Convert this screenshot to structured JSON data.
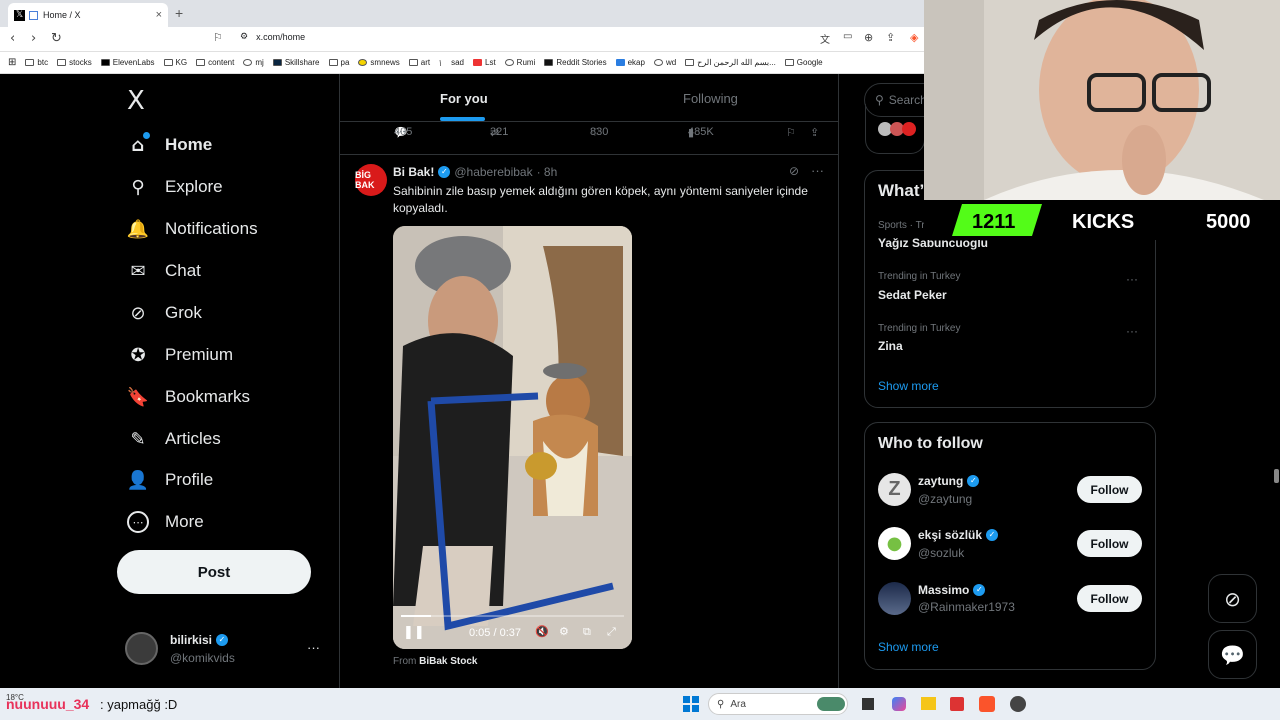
{
  "browser": {
    "tab_title": "Home / X",
    "tab_close": "×",
    "new_tab": "+",
    "url": "x.com/home",
    "bookmarks": [
      "btc",
      "stocks",
      "ElevenLabs",
      "KG",
      "content",
      "mj",
      "Skillshare",
      "pa",
      "smnews",
      "art",
      "sad",
      "Lst",
      "Rumi",
      "Reddit Stories",
      "ekap",
      "wd",
      "بسم الله الرحمن الرح...",
      "Google"
    ]
  },
  "sidebar": {
    "logo": "X",
    "items": [
      {
        "label": "Home",
        "icon": "home-icon",
        "glyph": "⌂"
      },
      {
        "label": "Explore",
        "icon": "search-icon",
        "glyph": "⚲"
      },
      {
        "label": "Notifications",
        "icon": "bell-icon",
        "glyph": "🔔"
      },
      {
        "label": "Chat",
        "icon": "mail-icon",
        "glyph": "✉"
      },
      {
        "label": "Grok",
        "icon": "grok-icon",
        "glyph": "⊘"
      },
      {
        "label": "Premium",
        "icon": "verified-icon",
        "glyph": "✪"
      },
      {
        "label": "Bookmarks",
        "icon": "bookmark-icon",
        "glyph": "🔖"
      },
      {
        "label": "Articles",
        "icon": "articles-icon",
        "glyph": "✎"
      },
      {
        "label": "Profile",
        "icon": "person-icon",
        "glyph": "👤"
      },
      {
        "label": "More",
        "icon": "more-icon",
        "glyph": "⋯"
      }
    ],
    "post_label": "Post",
    "account": {
      "name": "bilirkisi",
      "handle": "@komikvids",
      "menu": "···"
    }
  },
  "timeline": {
    "tabs": [
      "For you",
      "Following"
    ],
    "prev_actions": {
      "replies": "405",
      "reposts": "321",
      "likes": "830",
      "views": "485K"
    },
    "tweet": {
      "avatar_text": "BİG BAK",
      "name": "Bi Bak!",
      "handle": "@haberebibak",
      "time": "· 8h",
      "text": "Sahibinin zile basıp yemek aldığını gören köpek, aynı yöntemi saniyeler içinde kopyaladı.",
      "video_time": "0:05 / 0:37",
      "video_progress": 0.135,
      "from_prefix": "From",
      "from_source": "BiBak Stock"
    }
  },
  "right": {
    "search_placeholder": "Search",
    "trends_title": "What’s happening",
    "trends": [
      {
        "meta": "Sports · Trending",
        "name": "Yağız Sabuncuoğlu"
      },
      {
        "meta": "Trending in Turkey",
        "name": "Sedat Peker"
      },
      {
        "meta": "Trending in Turkey",
        "name": "Zina"
      }
    ],
    "trends_more": "Show more",
    "wtf_title": "Who to follow",
    "wtf": [
      {
        "name": "zaytung",
        "handle": "@zaytung",
        "follow": "Follow",
        "color": "#e7e7e7",
        "initial": "Z"
      },
      {
        "name": "ekşi sözlük",
        "handle": "@sozluk",
        "follow": "Follow",
        "color": "#ffffff",
        "initial": "●"
      },
      {
        "name": "Massimo",
        "handle": "@Rainmaker1973",
        "follow": "Follow",
        "color": "#2c3a5a",
        "initial": ""
      }
    ],
    "wtf_more": "Show more"
  },
  "overlay": {
    "kicks_count": "1211",
    "kicks_label": "KICKS",
    "kicks_goal": "5000",
    "chat_user": "nuunuuu_34",
    "chat_message": ": yapmağğ :D",
    "weather": "18°C"
  },
  "taskbar": {
    "search_placeholder": "Ara"
  }
}
